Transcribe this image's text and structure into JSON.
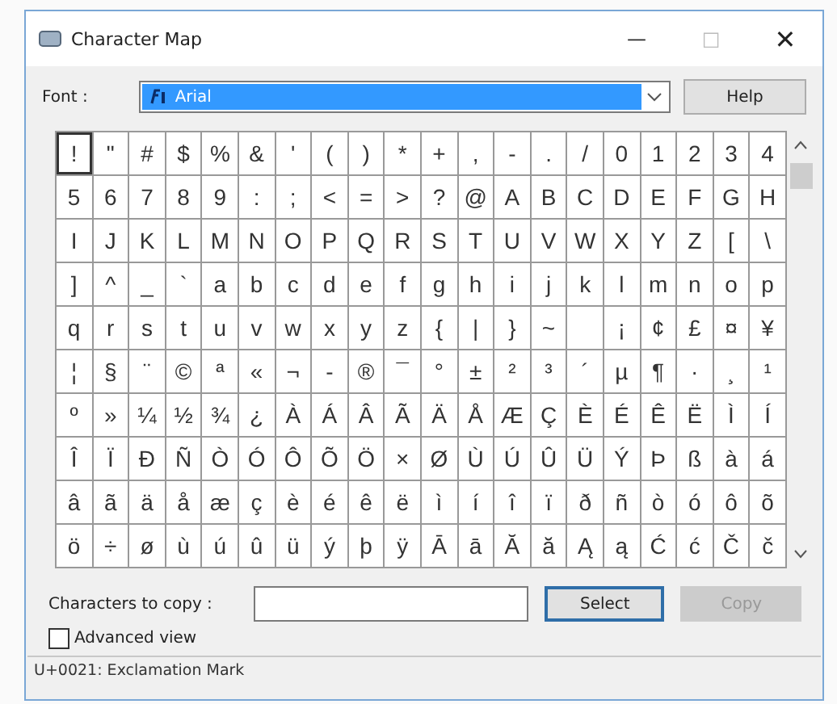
{
  "window": {
    "title": "Character Map",
    "controls": [
      "—",
      "□",
      "✕"
    ]
  },
  "font": {
    "label": "Font :",
    "value": "Arial",
    "selected": true
  },
  "help_button": "Help",
  "grid": {
    "rows": [
      [
        {
          "char": "!",
          "selected": true
        },
        {
          "char": "\"",
          "selected": false
        },
        {
          "char": "#",
          "selected": false
        },
        {
          "char": "$",
          "selected": false
        },
        {
          "char": "%",
          "selected": false
        },
        {
          "char": "&",
          "selected": false
        },
        {
          "char": "'",
          "selected": false
        },
        {
          "char": "(",
          "selected": false
        },
        {
          "char": ")",
          "selected": false
        },
        {
          "char": "*",
          "selected": false
        },
        {
          "char": "+",
          "selected": false
        },
        {
          "char": ",",
          "selected": false
        },
        {
          "char": "-",
          "selected": false
        },
        {
          "char": ".",
          "selected": false
        },
        {
          "char": "/",
          "selected": false
        },
        {
          "char": "0",
          "selected": false
        },
        {
          "char": "1",
          "selected": false
        },
        {
          "char": "2",
          "selected": false
        },
        {
          "char": "3",
          "selected": false
        },
        {
          "char": "4",
          "selected": false
        }
      ],
      [
        {
          "char": "5",
          "selected": false
        },
        {
          "char": "6",
          "selected": false
        },
        {
          "char": "7",
          "selected": false
        },
        {
          "char": "8",
          "selected": false
        },
        {
          "char": "9",
          "selected": false
        },
        {
          "char": ":",
          "selected": false
        },
        {
          "char": ";",
          "selected": false
        },
        {
          "char": "<",
          "selected": false
        },
        {
          "char": "=",
          "selected": false
        },
        {
          "char": ">",
          "selected": false
        },
        {
          "char": "?",
          "selected": false
        },
        {
          "char": "@",
          "selected": false
        },
        {
          "char": "A",
          "selected": false
        },
        {
          "char": "B",
          "selected": false
        },
        {
          "char": "C",
          "selected": false
        },
        {
          "char": "D",
          "selected": false
        },
        {
          "char": "E",
          "selected": false
        },
        {
          "char": "F",
          "selected": false
        },
        {
          "char": "G",
          "selected": false
        },
        {
          "char": "H",
          "selected": false
        }
      ],
      [
        {
          "char": "I",
          "selected": false
        },
        {
          "char": "J",
          "selected": false
        },
        {
          "char": "K",
          "selected": false
        },
        {
          "char": "L",
          "selected": false
        },
        {
          "char": "M",
          "selected": false
        },
        {
          "char": "N",
          "selected": false
        },
        {
          "char": "O",
          "selected": false
        },
        {
          "char": "P",
          "selected": false
        },
        {
          "char": "Q",
          "selected": false
        },
        {
          "char": "R",
          "selected": false
        },
        {
          "char": "S",
          "selected": false
        },
        {
          "char": "T",
          "selected": false
        },
        {
          "char": "U",
          "selected": false
        },
        {
          "char": "V",
          "selected": false
        },
        {
          "char": "W",
          "selected": false
        },
        {
          "char": "X",
          "selected": false
        },
        {
          "char": "Y",
          "selected": false
        },
        {
          "char": "Z",
          "selected": false
        },
        {
          "char": "[",
          "selected": false
        },
        {
          "char": "\\",
          "selected": false
        }
      ],
      [
        {
          "char": "]",
          "selected": false
        },
        {
          "char": "^",
          "selected": false
        },
        {
          "char": "_",
          "selected": false
        },
        {
          "char": "`",
          "selected": false
        },
        {
          "char": "a",
          "selected": false
        },
        {
          "char": "b",
          "selected": false
        },
        {
          "char": "c",
          "selected": false
        },
        {
          "char": "d",
          "selected": false
        },
        {
          "char": "e",
          "selected": false
        },
        {
          "char": "f",
          "selected": false
        },
        {
          "char": "g",
          "selected": false
        },
        {
          "char": "h",
          "selected": false
        },
        {
          "char": "i",
          "selected": false
        },
        {
          "char": "j",
          "selected": false
        },
        {
          "char": "k",
          "selected": false
        },
        {
          "char": "l",
          "selected": false
        },
        {
          "char": "m",
          "selected": false
        },
        {
          "char": "n",
          "selected": false
        },
        {
          "char": "o",
          "selected": false
        },
        {
          "char": "p",
          "selected": false
        }
      ],
      [
        {
          "char": "q",
          "selected": false
        },
        {
          "char": "r",
          "selected": false
        },
        {
          "char": "s",
          "selected": false
        },
        {
          "char": "t",
          "selected": false
        },
        {
          "char": "u",
          "selected": false
        },
        {
          "char": "v",
          "selected": false
        },
        {
          "char": "w",
          "selected": false
        },
        {
          "char": "x",
          "selected": false
        },
        {
          "char": "y",
          "selected": false
        },
        {
          "char": "z",
          "selected": false
        },
        {
          "char": "{",
          "selected": false
        },
        {
          "char": "|",
          "selected": false
        },
        {
          "char": "}",
          "selected": false
        },
        {
          "char": "~",
          "selected": false
        },
        {
          "selected": false
        },
        {
          "char": "¡",
          "selected": false
        },
        {
          "char": "¢",
          "selected": false
        },
        {
          "char": "£",
          "selected": false
        },
        {
          "char": "¤",
          "selected": false
        },
        {
          "char": "¥",
          "selected": false
        }
      ],
      [
        {
          "char": "¦",
          "selected": false
        },
        {
          "char": "§",
          "selected": false
        },
        {
          "char": "¨",
          "selected": false
        },
        {
          "char": "©",
          "selected": false
        },
        {
          "char": "ª",
          "selected": false
        },
        {
          "char": "«",
          "selected": false
        },
        {
          "char": "¬",
          "selected": false
        },
        {
          "char": "-",
          "selected": false
        },
        {
          "char": "®",
          "selected": false
        },
        {
          "char": "¯",
          "selected": false
        },
        {
          "char": "°",
          "selected": false
        },
        {
          "char": "±",
          "selected": false
        },
        {
          "char": "²",
          "selected": false
        },
        {
          "char": "³",
          "selected": false
        },
        {
          "char": "´",
          "selected": false
        },
        {
          "char": "µ",
          "selected": false
        },
        {
          "char": "¶",
          "selected": false
        },
        {
          "char": "·",
          "selected": false
        },
        {
          "char": "¸",
          "selected": false
        },
        {
          "char": "¹",
          "selected": false
        }
      ],
      [
        {
          "char": "º",
          "selected": false
        },
        {
          "char": "»",
          "selected": false
        },
        {
          "char": "¼",
          "selected": false
        },
        {
          "char": "½",
          "selected": false
        },
        {
          "char": "¾",
          "selected": false
        },
        {
          "char": "¿",
          "selected": false
        },
        {
          "char": "À",
          "selected": false
        },
        {
          "char": "Á",
          "selected": false
        },
        {
          "char": "Â",
          "selected": false
        },
        {
          "char": "Ã",
          "selected": false
        },
        {
          "char": "Ä",
          "selected": false
        },
        {
          "char": "Å",
          "selected": false
        },
        {
          "char": "Æ",
          "selected": false
        },
        {
          "char": "Ç",
          "selected": false
        },
        {
          "char": "È",
          "selected": false
        },
        {
          "char": "É",
          "selected": false
        },
        {
          "char": "Ê",
          "selected": false
        },
        {
          "char": "Ë",
          "selected": false
        },
        {
          "char": "Ì",
          "selected": false
        },
        {
          "char": "Í",
          "selected": false
        }
      ],
      [
        {
          "char": "Î",
          "selected": false
        },
        {
          "char": "Ï",
          "selected": false
        },
        {
          "char": "Ð",
          "selected": false
        },
        {
          "char": "Ñ",
          "selected": false
        },
        {
          "char": "Ò",
          "selected": false
        },
        {
          "char": "Ó",
          "selected": false
        },
        {
          "char": "Ô",
          "selected": false
        },
        {
          "char": "Õ",
          "selected": false
        },
        {
          "char": "Ö",
          "selected": false
        },
        {
          "char": "×",
          "selected": false
        },
        {
          "char": "Ø",
          "selected": false
        },
        {
          "char": "Ù",
          "selected": false
        },
        {
          "char": "Ú",
          "selected": false
        },
        {
          "char": "Û",
          "selected": false
        },
        {
          "char": "Ü",
          "selected": false
        },
        {
          "char": "Ý",
          "selected": false
        },
        {
          "char": "Þ",
          "selected": false
        },
        {
          "char": "ß",
          "selected": false
        },
        {
          "char": "à",
          "selected": false
        },
        {
          "char": "á",
          "selected": false
        }
      ],
      [
        {
          "char": "â",
          "selected": false
        },
        {
          "char": "ã",
          "selected": false
        },
        {
          "char": "ä",
          "selected": false
        },
        {
          "char": "å",
          "selected": false
        },
        {
          "char": "æ",
          "selected": false
        },
        {
          "char": "ç",
          "selected": false
        },
        {
          "char": "è",
          "selected": false
        },
        {
          "char": "é",
          "selected": false
        },
        {
          "char": "ê",
          "selected": false
        },
        {
          "char": "ë",
          "selected": false
        },
        {
          "char": "ì",
          "selected": false
        },
        {
          "char": "í",
          "selected": false
        },
        {
          "char": "î",
          "selected": false
        },
        {
          "char": "ï",
          "selected": false
        },
        {
          "char": "ð",
          "selected": false
        },
        {
          "char": "ñ",
          "selected": false
        },
        {
          "char": "ò",
          "selected": false
        },
        {
          "char": "ó",
          "selected": false
        },
        {
          "char": "ô",
          "selected": false
        },
        {
          "char": "õ",
          "selected": false
        }
      ],
      [
        {
          "char": "ö",
          "selected": false
        },
        {
          "char": "÷",
          "selected": false
        },
        {
          "char": "ø",
          "selected": false
        },
        {
          "char": "ù",
          "selected": false
        },
        {
          "char": "ú",
          "selected": false
        },
        {
          "char": "û",
          "selected": false
        },
        {
          "char": "ü",
          "selected": false
        },
        {
          "char": "ý",
          "selected": false
        },
        {
          "char": "þ",
          "selected": false
        },
        {
          "char": "ÿ",
          "selected": false
        },
        {
          "char": "Ā",
          "selected": false
        },
        {
          "char": "ā",
          "selected": false
        },
        {
          "char": "Ă",
          "selected": false
        },
        {
          "char": "ă",
          "selected": false
        },
        {
          "char": "Ą",
          "selected": false
        },
        {
          "char": "ą",
          "selected": false
        },
        {
          "char": "Ć",
          "selected": false
        },
        {
          "char": "ć",
          "selected": false
        },
        {
          "char": "Č",
          "selected": false
        },
        {
          "char": "č",
          "selected": false
        }
      ]
    ]
  },
  "copy": {
    "label": "Characters to copy :",
    "select_button": {
      "label": "Select",
      "disabled": false
    },
    "copy_button": {
      "label": "Copy",
      "disabled": true
    }
  },
  "advanced_view": {
    "label": "Advanced view",
    "checked": false
  },
  "status_bar": "U+0021: Exclamation Mark"
}
